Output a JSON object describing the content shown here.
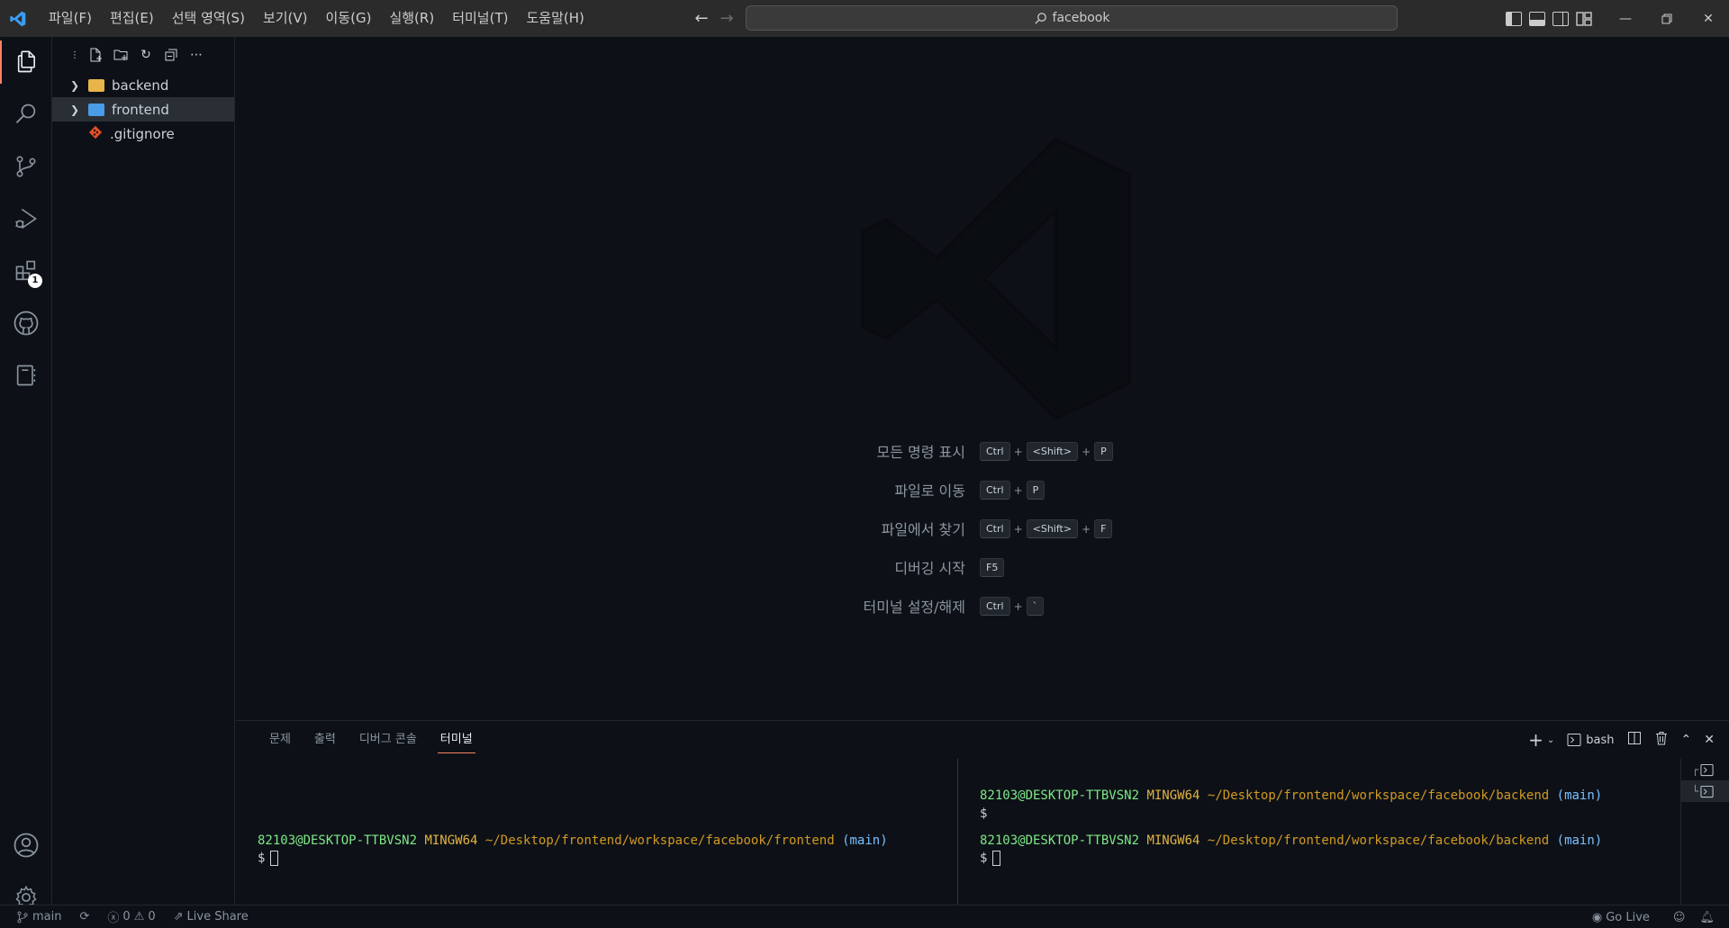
{
  "titlebar": {
    "menu": [
      "파일(F)",
      "편집(E)",
      "선택 영역(S)",
      "보기(V)",
      "이동(G)",
      "실행(R)",
      "터미널(T)",
      "도움말(H)"
    ],
    "search_text": "facebook"
  },
  "activitybar": {
    "extensions_badge": "1"
  },
  "explorer": {
    "items": [
      {
        "label": "backend",
        "type": "folder"
      },
      {
        "label": "frontend",
        "type": "folder"
      },
      {
        "label": ".gitignore",
        "type": "file"
      }
    ]
  },
  "welcome": {
    "shortcuts": [
      {
        "label": "모든 명령 표시",
        "keys": [
          "Ctrl",
          "<Shift>",
          "P"
        ]
      },
      {
        "label": "파일로 이동",
        "keys": [
          "Ctrl",
          "P"
        ]
      },
      {
        "label": "파일에서 찾기",
        "keys": [
          "Ctrl",
          "<Shift>",
          "F"
        ]
      },
      {
        "label": "디버깅 시작",
        "keys": [
          "F5"
        ]
      },
      {
        "label": "터미널 설정/해제",
        "keys": [
          "Ctrl",
          "`"
        ]
      }
    ]
  },
  "panel": {
    "tabs": [
      "문제",
      "출력",
      "디버그 콘솔",
      "터미널"
    ],
    "active_tab": "터미널",
    "shell_label": "bash",
    "terminals": {
      "left": {
        "user": "82103@DESKTOP-TTBVSN2",
        "mingw": "MINGW64",
        "path": "~/Desktop/frontend/workspace/facebook/frontend",
        "branch": "(main)",
        "prompt": "$"
      },
      "right_first": {
        "user": "82103@DESKTOP-TTBVSN2",
        "mingw": "MINGW64",
        "path": "~/Desktop/frontend/workspace/facebook/backend",
        "branch": "(main)",
        "prompt": "$"
      },
      "right_second": {
        "user": "82103@DESKTOP-TTBVSN2",
        "mingw": "MINGW64",
        "path": "~/Desktop/frontend/workspace/facebook/backend",
        "branch": "(main)",
        "prompt": "$"
      }
    }
  },
  "statusbar": {
    "branch": "main",
    "errors": "0",
    "warnings": "0",
    "live_share": "Live Share",
    "go_live": "Go Live"
  },
  "colors": {
    "background": "#0d1117",
    "accent": "#f78166",
    "titlebar": "#2b2b2b",
    "terminal_user": "#7ee787",
    "terminal_path": "#d29922",
    "terminal_branch": "#79c0ff"
  }
}
